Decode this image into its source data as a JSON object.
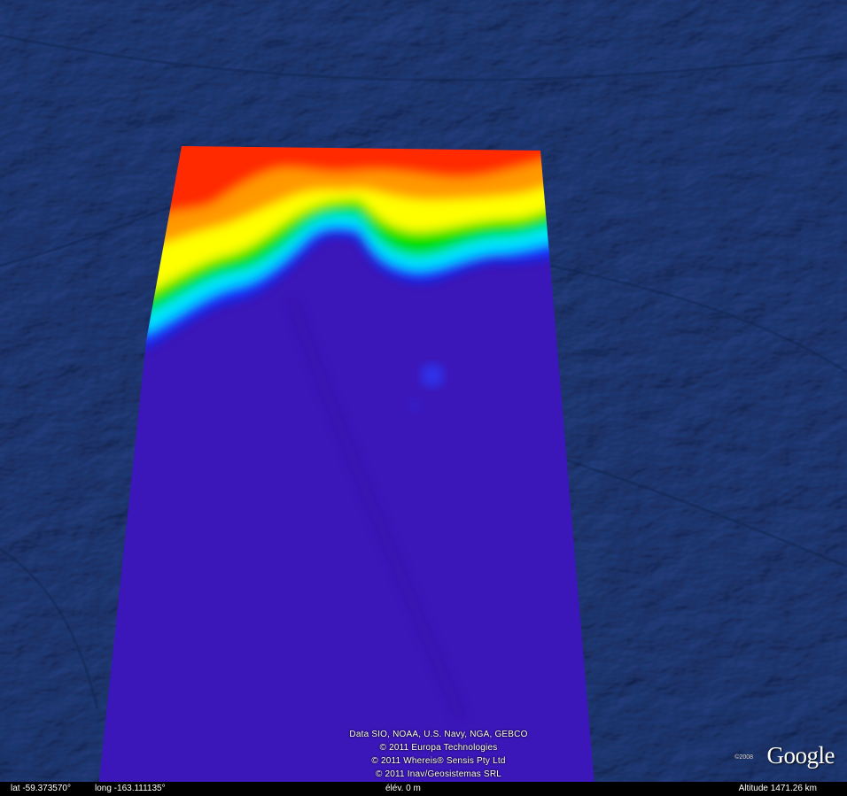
{
  "map": {
    "overlay_colors": [
      "#3b16b8",
      "#1030ff",
      "#00e5ff",
      "#00e000",
      "#ffff00",
      "#ff9900",
      "#ff2a00"
    ],
    "ocean_color": "#1c3a73"
  },
  "credits": [
    "Data SIO, NOAA, U.S. Navy, NGA, GEBCO",
    "© 2011 Europa Technologies",
    "© 2011 Whereis® Sensis Pty Ltd",
    "© 2011 Inav/Geosistemas SRL"
  ],
  "branding": {
    "logo_text": "Google",
    "logo_copyright": "©2008"
  },
  "status": {
    "lat": "lat  -59.373570°",
    "long": "long  -163.111135°",
    "elev": "élév.    0 m",
    "altitude": "Altitude  1471.26 km"
  }
}
